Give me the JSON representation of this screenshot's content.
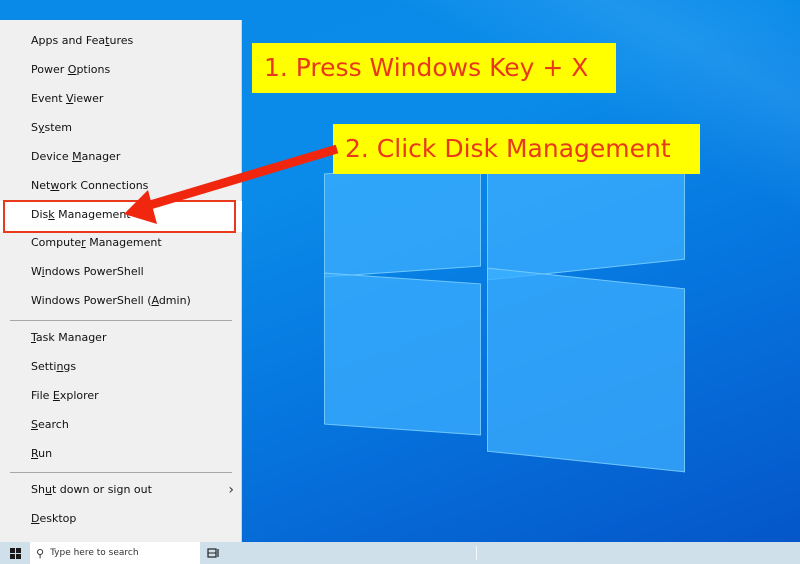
{
  "menu": {
    "items": [
      {
        "label": "Apps and Features",
        "access_key_index": 12
      },
      {
        "label": "Power Options",
        "access_key_index": 6
      },
      {
        "label": "Event Viewer",
        "access_key_index": 6
      },
      {
        "label": "System",
        "access_key_index": 1
      },
      {
        "label": "Device Manager",
        "access_key_index": 7
      },
      {
        "label": "Network Connections",
        "access_key_index": 3
      },
      {
        "label": "Disk Management",
        "access_key_index": 3
      },
      {
        "label": "Computer Management",
        "access_key_index": 7
      },
      {
        "label": "Windows PowerShell",
        "access_key_index": 1
      },
      {
        "label": "Windows PowerShell (Admin)",
        "access_key_index": 20
      },
      {
        "label": "Task Manager",
        "access_key_index": 0
      },
      {
        "label": "Settings",
        "access_key_index": 5
      },
      {
        "label": "File Explorer",
        "access_key_index": 5
      },
      {
        "label": "Search",
        "access_key_index": 0
      },
      {
        "label": "Run",
        "access_key_index": 0
      },
      {
        "label": "Shut down or sign out",
        "access_key_index": 2,
        "has_submenu": true
      },
      {
        "label": "Desktop",
        "access_key_index": 0
      }
    ],
    "highlighted": "Disk Management"
  },
  "taskbar": {
    "search_placeholder": "Type here to search",
    "start_icon": "windows-logo-icon",
    "search_icon": "search-icon",
    "taskview_icon": "task-view-icon"
  },
  "annotations": {
    "step1": "1. Press Windows Key + X",
    "step2": "2. Click Disk Management",
    "text_color": "#e8391d",
    "background_color": "#ffff00",
    "arrow_color": "#f0260f"
  }
}
